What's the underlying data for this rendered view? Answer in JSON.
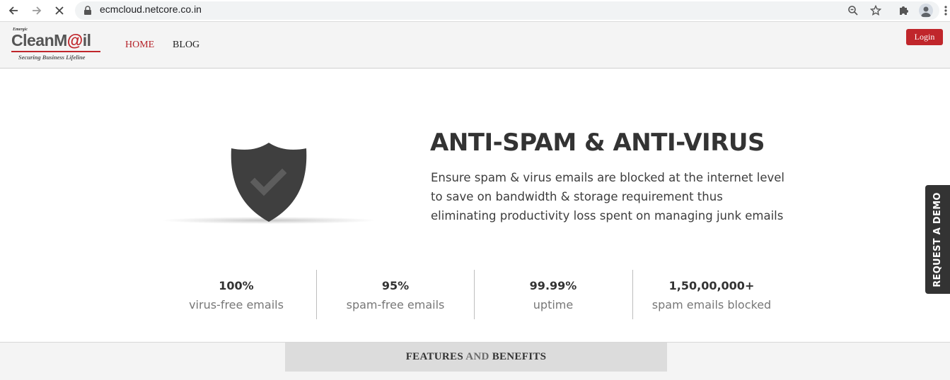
{
  "browser": {
    "url": "ecmcloud.netcore.co.in",
    "icons": [
      "back-arrow-icon",
      "forward-arrow-icon",
      "stop-loading-icon",
      "lock-icon",
      "zoom-icon",
      "star-icon",
      "extensions-icon",
      "profile-icon",
      "menu-dots-icon"
    ]
  },
  "header": {
    "logo": {
      "top_text": "Emergic",
      "brand_prefix": "CleanM",
      "brand_at": "@",
      "brand_suffix": "il",
      "tagline": "Securing Business Lifeline"
    },
    "nav": [
      {
        "label": "HOME",
        "active": true
      },
      {
        "label": "BLOG",
        "active": false
      }
    ],
    "login_label": "Login"
  },
  "hero": {
    "title": "ANTI-SPAM & ANTI-VIRUS",
    "description": "Ensure spam & virus emails are blocked at the internet level to save on bandwidth & storage requirement thus eliminating productivity loss spent on managing junk emails",
    "icon": "shield-check-icon"
  },
  "stats": [
    {
      "value": "100%",
      "label": "virus-free emails"
    },
    {
      "value": "95%",
      "label": "spam-free emails"
    },
    {
      "value": "99.99%",
      "label": "uptime"
    },
    {
      "value": "1,50,00,000+",
      "label": "spam emails blocked"
    }
  ],
  "demo_tab": {
    "label": "REQUEST A DEMO"
  },
  "features": {
    "part1": "FEATURES",
    "part2": " AND ",
    "part3": "BENEFITS"
  },
  "colors": {
    "accent_red": "#c0262b",
    "text_dark": "#333333",
    "demo_tab_bg": "#333333"
  }
}
